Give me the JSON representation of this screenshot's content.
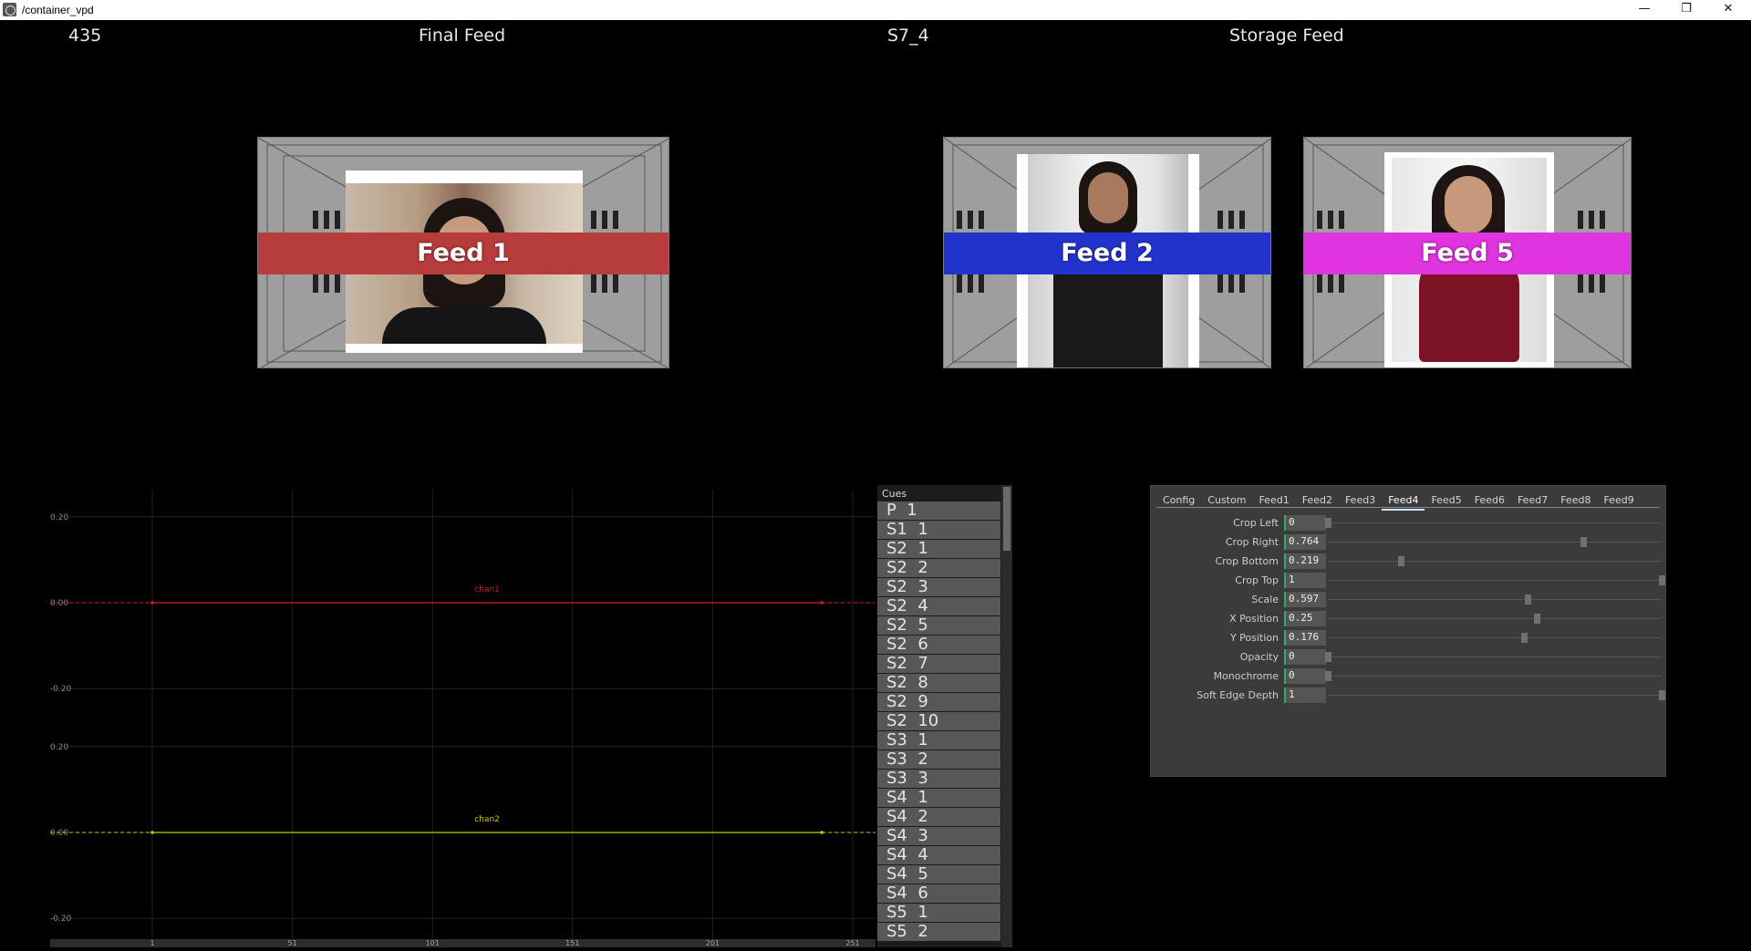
{
  "window": {
    "title": "/container_vpd",
    "minimize": "—",
    "restore": "❐",
    "close": "✕"
  },
  "header": {
    "frame": "435",
    "final_feed": "Final Feed",
    "cue_name": "S7_4",
    "storage_feed": "Storage Feed"
  },
  "feeds": [
    {
      "label": "Feed 1",
      "band_color": "#b73c3c"
    },
    {
      "label": "Feed 2",
      "band_color": "#2233cc"
    },
    {
      "label": "Feed 5",
      "band_color": "#e034e0"
    }
  ],
  "chart_data": {
    "type": "line",
    "x_ticks": [
      "1",
      "51",
      "101",
      "151",
      "201",
      "251"
    ],
    "panels": [
      {
        "y_ticks": [
          "0.20",
          "0.00",
          "-0.20"
        ],
        "series": [
          {
            "name": "chan1",
            "color": "#d02020",
            "x": [
              1,
              240
            ],
            "y": [
              0.0,
              0.0
            ]
          }
        ]
      },
      {
        "y_ticks": [
          "0.20",
          "0.00",
          "-0.20"
        ],
        "series": [
          {
            "name": "chan2",
            "color": "#c8c800",
            "x": [
              1,
              240
            ],
            "y": [
              0.0,
              0.0
            ]
          }
        ]
      }
    ]
  },
  "cues": {
    "title": "Cues",
    "items": [
      "P  1",
      "S1  1",
      "S2  1",
      "S2  2",
      "S2  3",
      "S2  4",
      "S2  5",
      "S2  6",
      "S2  7",
      "S2  8",
      "S2  9",
      "S2  10",
      "S3  1",
      "S3  2",
      "S3  3",
      "S4  1",
      "S4  2",
      "S4  3",
      "S4  4",
      "S4  5",
      "S4  6",
      "S5  1",
      "S5  2"
    ]
  },
  "params": {
    "tabs": [
      "Config",
      "Custom",
      "Feed1",
      "Feed2",
      "Feed3",
      "Feed4",
      "Feed5",
      "Feed6",
      "Feed7",
      "Feed8",
      "Feed9"
    ],
    "active_tab": "Feed4",
    "rows": [
      {
        "label": "Crop Left",
        "value": "0",
        "fraction": 0.0
      },
      {
        "label": "Crop Right",
        "value": "0.764",
        "fraction": 0.764
      },
      {
        "label": "Crop Bottom",
        "value": "0.219",
        "fraction": 0.219
      },
      {
        "label": "Crop Top",
        "value": "1",
        "fraction": 1.0
      },
      {
        "label": "Scale",
        "value": "0.597",
        "fraction": 0.597
      },
      {
        "label": "X Position",
        "value": "0.25",
        "fraction": 0.625
      },
      {
        "label": "Y Position",
        "value": "0.176",
        "fraction": 0.588
      },
      {
        "label": "Opacity",
        "value": "0",
        "fraction": 0.0
      },
      {
        "label": "Monochrome",
        "value": "0",
        "fraction": 0.0
      },
      {
        "label": "Soft Edge Depth",
        "value": "1",
        "fraction": 1.0
      }
    ]
  }
}
